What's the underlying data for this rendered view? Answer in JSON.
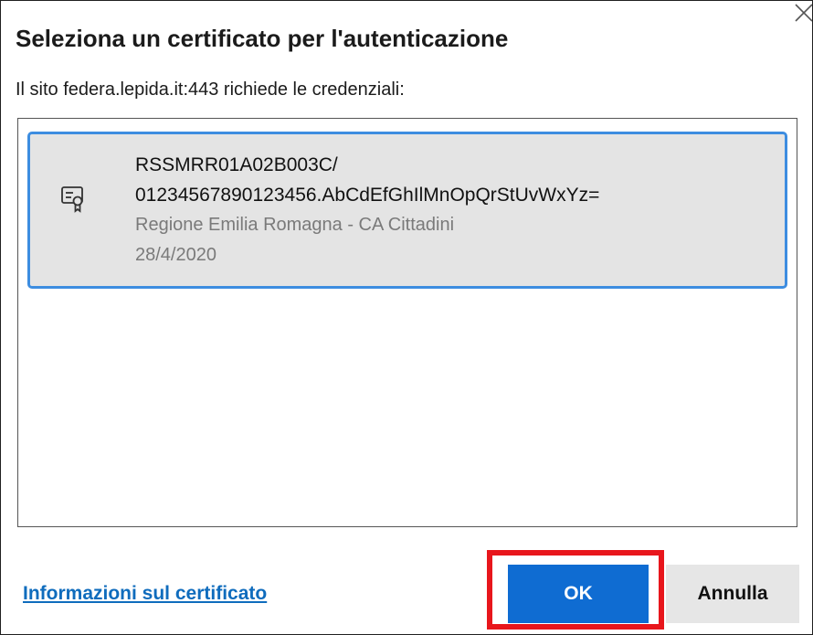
{
  "dialog": {
    "title": "Seleziona un certificato per l'autenticazione",
    "subtitle": "Il sito federa.lepida.it:443 richiede le credenziali:",
    "close_icon": "close-icon"
  },
  "certificates": [
    {
      "icon": "certificate-icon",
      "subject_line1": "RSSMRR01A02B003C/",
      "subject_line2": "01234567890123456.AbCdEfGhIlMnOpQrStUvWxYz=",
      "issuer": "Regione Emilia Romagna - CA Cittadini",
      "date": "28/4/2020",
      "selected": true
    }
  ],
  "footer": {
    "info_link": "Informazioni sul certificato",
    "ok_label": "OK",
    "cancel_label": "Annulla"
  },
  "colors": {
    "accent": "#0f6cd2",
    "selection_border": "#3d8de0",
    "selection_bg": "#e4e4e4",
    "link": "#0f6cbd",
    "highlight_box": "#e8161c"
  }
}
